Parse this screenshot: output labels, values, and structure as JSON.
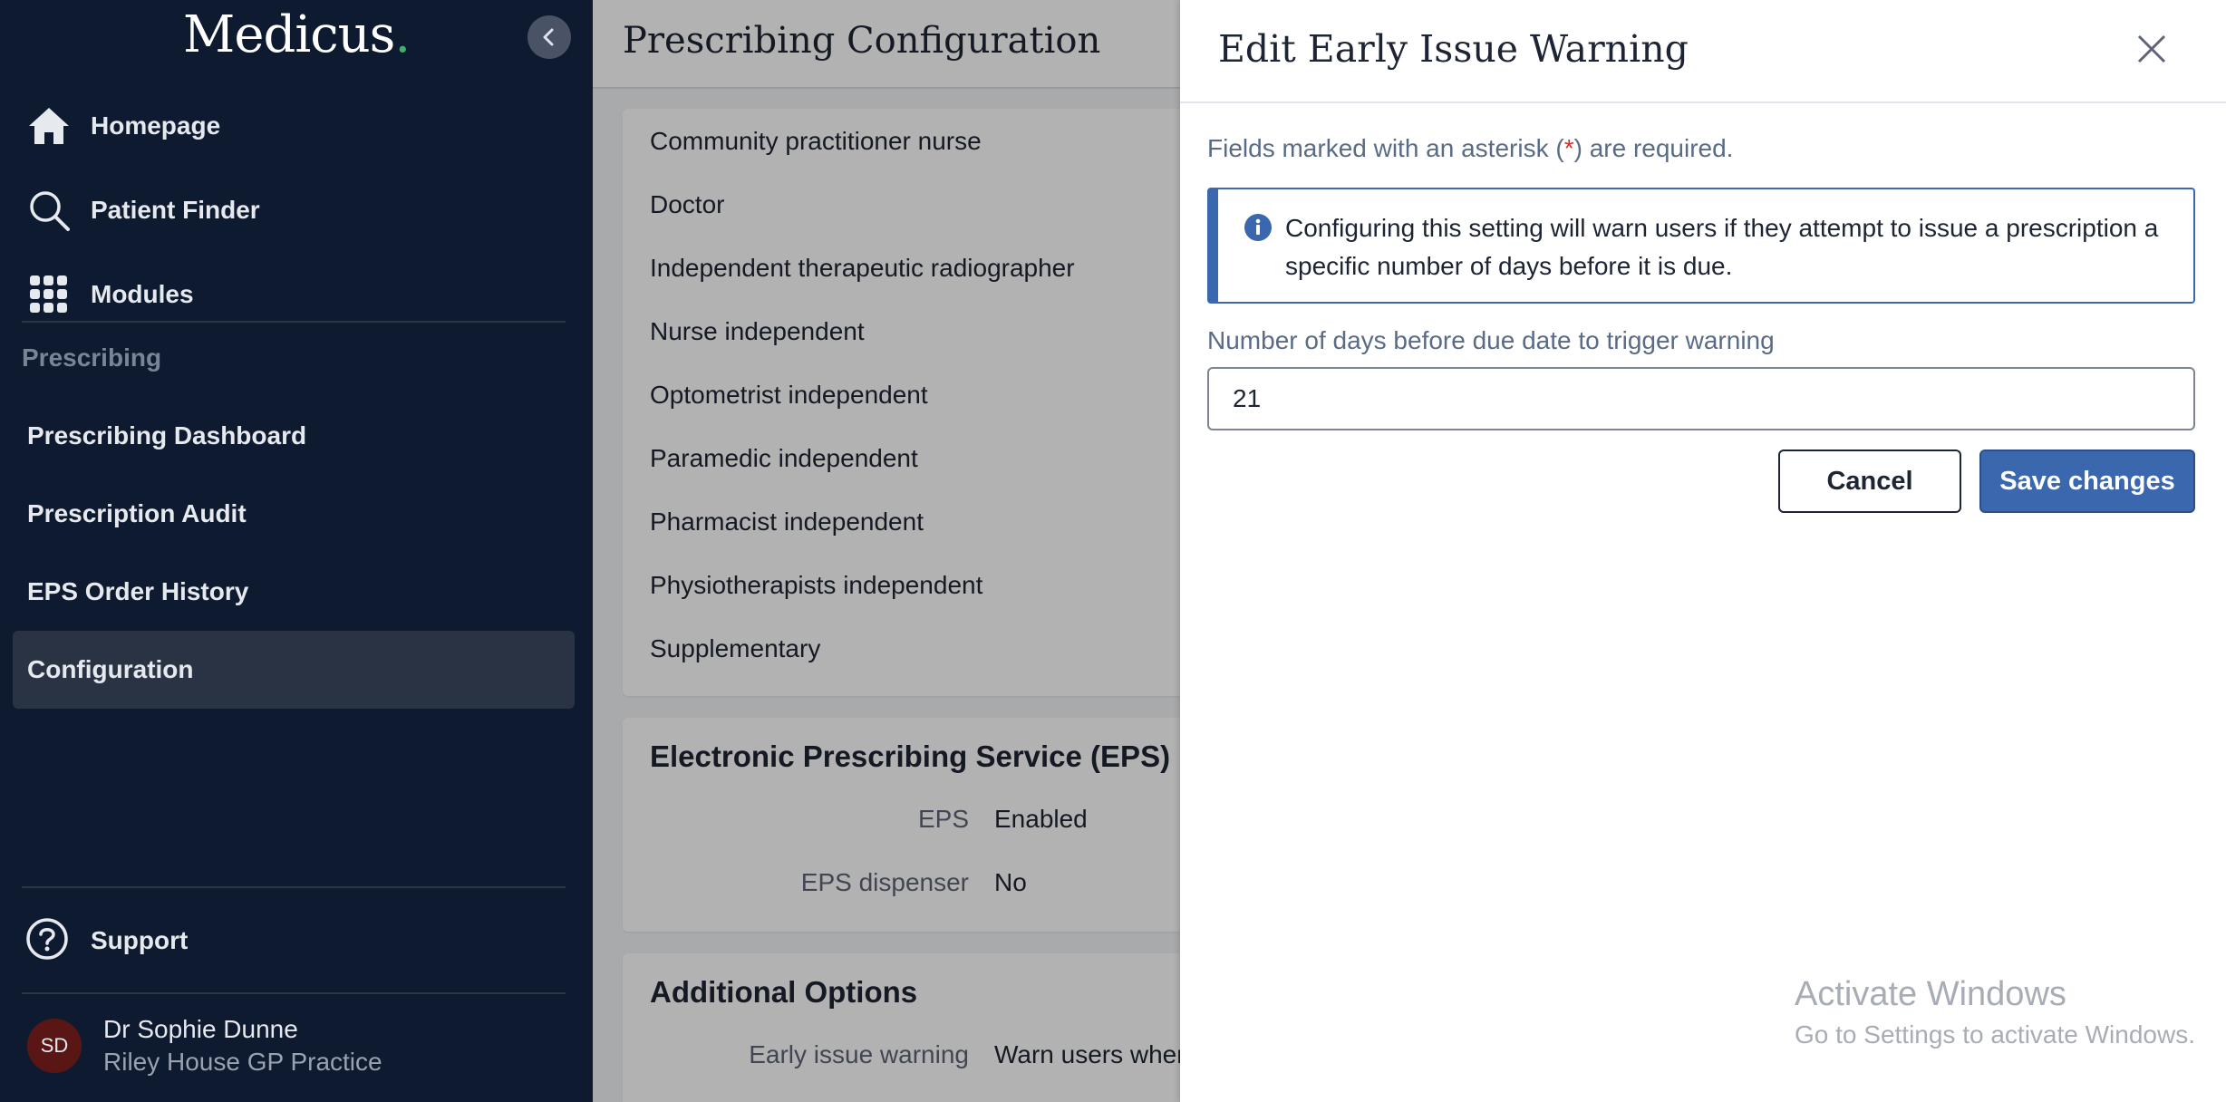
{
  "sidebar": {
    "logo": "Medicus",
    "logo_dot": ".",
    "nav": [
      {
        "label": "Homepage"
      },
      {
        "label": "Patient Finder"
      },
      {
        "label": "Modules"
      }
    ],
    "section_label": "Prescribing",
    "sub_nav": [
      {
        "label": "Prescribing Dashboard"
      },
      {
        "label": "Prescription Audit"
      },
      {
        "label": "EPS Order History"
      },
      {
        "label": "Configuration",
        "active": true
      }
    ],
    "support_label": "Support",
    "user": {
      "initials": "SD",
      "name": "Dr Sophie Dunne",
      "practice": "Riley House GP Practice"
    }
  },
  "main": {
    "title": "Prescribing Configuration",
    "roles": [
      "Community practitioner nurse",
      "Doctor",
      "Independent therapeutic radiographer",
      "Nurse independent",
      "Optometrist independent",
      "Paramedic independent",
      "Pharmacist independent",
      "Physiotherapists independent",
      "Supplementary"
    ],
    "eps": {
      "title": "Electronic Prescribing Service (EPS)",
      "rows": [
        {
          "label": "EPS",
          "value": "Enabled"
        },
        {
          "label": "EPS dispenser",
          "value": "No"
        }
      ]
    },
    "additional": {
      "title": "Additional Options",
      "rows": [
        {
          "label": "Early issue warning",
          "value": "Warn users when is"
        }
      ]
    }
  },
  "panel": {
    "title": "Edit Early Issue Warning",
    "required_prefix": "Fields marked with an asterisk (",
    "required_asterisk": "*",
    "required_suffix": ") are required.",
    "info_text": "Configuring this setting will warn users if they attempt to issue a prescription a specific number of days before it is due.",
    "field_label": "Number of days before due date to trigger warning",
    "field_value": "21",
    "cancel_label": "Cancel",
    "save_label": "Save changes"
  },
  "watermark": {
    "title": "Activate Windows",
    "subtitle": "Go to Settings to activate Windows."
  },
  "colors": {
    "sidebar_bg": "#0e1a30",
    "accent": "#3a67ad",
    "logo_dot": "#3fb06b",
    "required_asterisk": "#d0312d"
  }
}
